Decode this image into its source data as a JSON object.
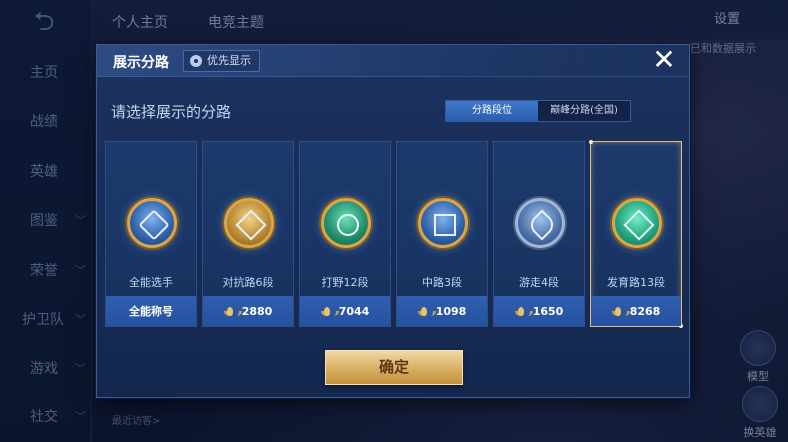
{
  "background": {
    "sidebar": [
      {
        "label": "主页",
        "active": true,
        "chevron": false
      },
      {
        "label": "战绩",
        "active": false,
        "chevron": false
      },
      {
        "label": "英雄",
        "active": false,
        "chevron": false
      },
      {
        "label": "图鉴",
        "active": false,
        "chevron": true
      },
      {
        "label": "荣誉",
        "active": false,
        "chevron": true
      },
      {
        "label": "护卫队",
        "active": false,
        "chevron": true
      },
      {
        "label": "游戏",
        "active": false,
        "chevron": true
      },
      {
        "label": "社交",
        "active": false,
        "chevron": true
      }
    ],
    "top_tabs": [
      "个人主页",
      "电竞主题"
    ],
    "settings_label": "设置",
    "side_text": "已和数据展示",
    "visitor_text": "最近访客>",
    "model_label": "模型",
    "switch_hero_label": "换英雄"
  },
  "modal": {
    "title": "展示分路",
    "priority_label": "优先显示",
    "close_glyph": "✕",
    "prompt": "请选择展示的分路",
    "toggle": {
      "options": [
        "分路段位",
        "巅峰分路(全国)"
      ],
      "active_index": 0
    },
    "cards": [
      {
        "role": "全能选手",
        "foot": "全能称号",
        "show_icon": false,
        "emblem": "allround",
        "selected": false
      },
      {
        "role": "对抗路6段",
        "foot": "2880",
        "show_icon": true,
        "emblem": "clash",
        "selected": false
      },
      {
        "role": "打野12段",
        "foot": "7044",
        "show_icon": true,
        "emblem": "jungle",
        "selected": false
      },
      {
        "role": "中路3段",
        "foot": "1098",
        "show_icon": true,
        "emblem": "mid",
        "selected": false
      },
      {
        "role": "游走4段",
        "foot": "1650",
        "show_icon": true,
        "emblem": "roam",
        "selected": false
      },
      {
        "role": "发育路13段",
        "foot": "8268",
        "show_icon": true,
        "emblem": "adc",
        "selected": true
      }
    ],
    "confirm_label": "确定"
  },
  "colors": {
    "accent_blue": "#2c5eae",
    "gold": "#d9ae62",
    "selected_border": "#e7b97a"
  }
}
